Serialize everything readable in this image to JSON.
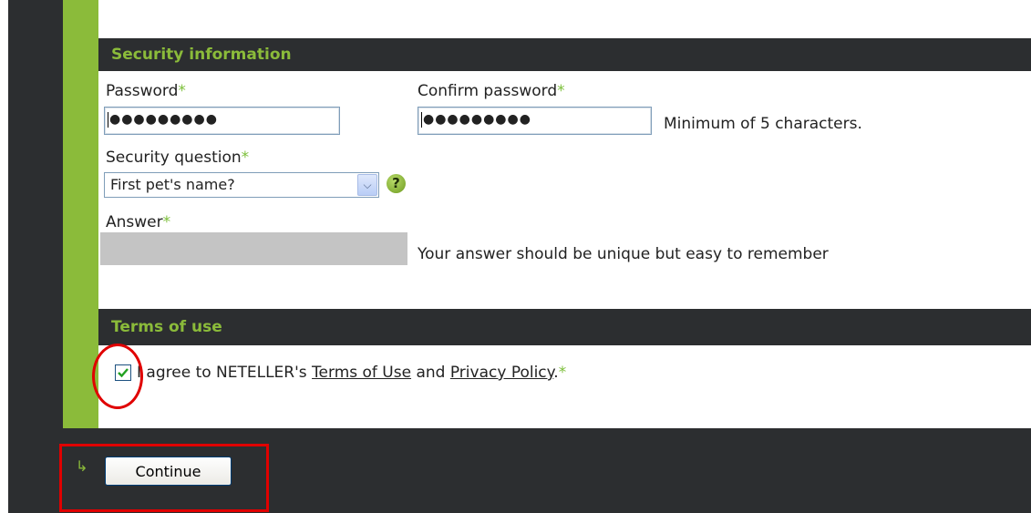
{
  "security_section": {
    "title": "Security information",
    "password_label": "Password",
    "confirm_password_label": "Confirm password",
    "password_value": "●●●●●●●●●",
    "confirm_password_value": "●●●●●●●●●",
    "password_hint": "Minimum of 5 characters.",
    "security_question_label": "Security question",
    "security_question_value": "First pet's name?",
    "help_symbol": "?",
    "answer_label": "Answer",
    "answer_hint": "Your answer should be unique but easy to remember",
    "required_marker": "*"
  },
  "terms_section": {
    "title": "Terms of use",
    "agree_checked": true,
    "agree_text_prefix": "I agree to NETELLER's ",
    "terms_link": "Terms of Use",
    "and_text": " and ",
    "privacy_link": "Privacy Policy",
    "period": "."
  },
  "actions": {
    "arrow_symbol": "↳",
    "continue_label": "Continue"
  },
  "colors": {
    "accent_green": "#8bbb3a",
    "dark_frame": "#2c2e30",
    "annotation_red": "#e00000"
  }
}
